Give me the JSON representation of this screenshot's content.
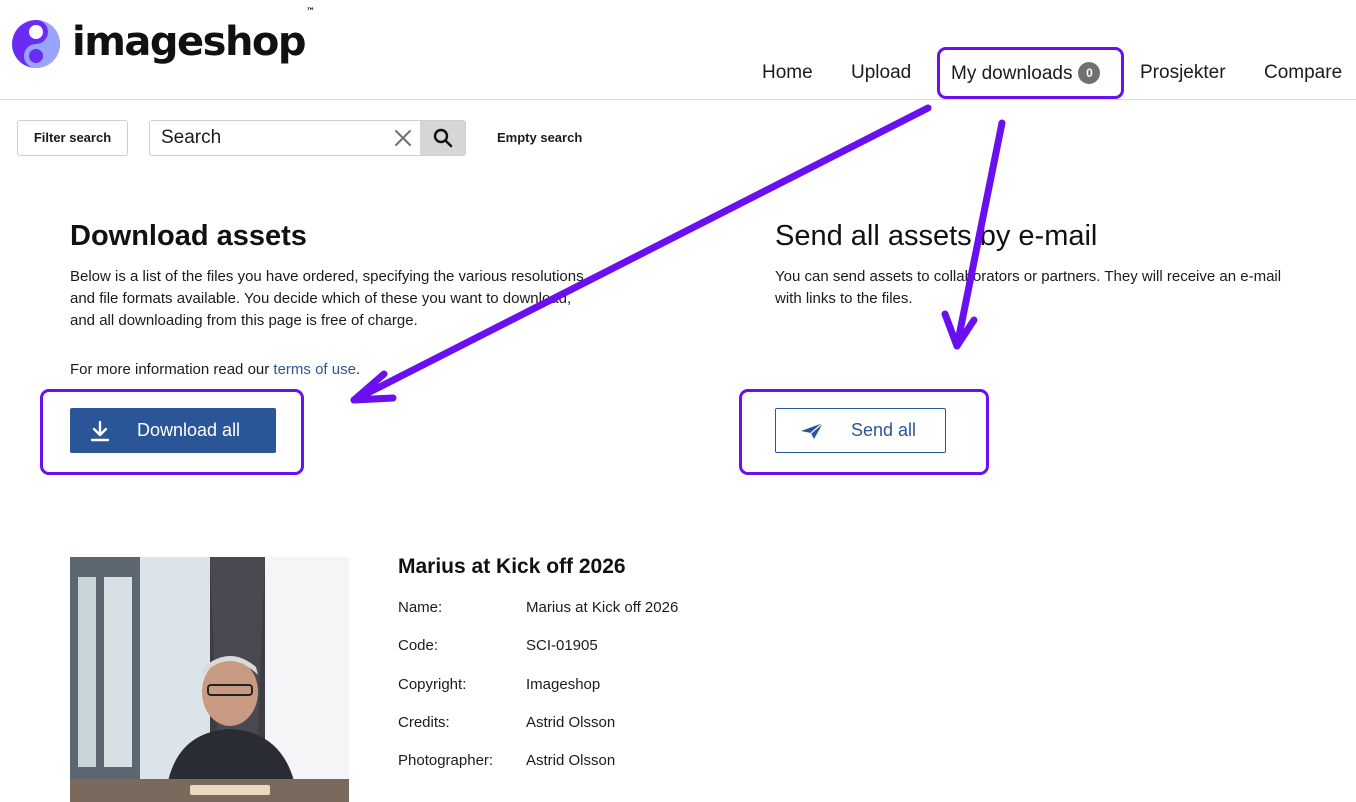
{
  "brand": {
    "name": "imageshop",
    "trademark": "™"
  },
  "nav": {
    "home": "Home",
    "upload": "Upload",
    "my_downloads": "My downloads",
    "my_downloads_count": "0",
    "projects": "Prosjekter",
    "compare": "Compare"
  },
  "search": {
    "filter_label": "Filter search",
    "placeholder": "Search",
    "value": "",
    "empty_label": "Empty search"
  },
  "download": {
    "heading": "Download assets",
    "text_line1": "Below is a list of the files you have ordered, specifying the various resolutions",
    "text_line2": "and file formats available. You decide which of these you want to download,",
    "text_line3": "and all downloading from this page is free of charge.",
    "info_prefix": "For more information read our ",
    "info_link": "terms of use",
    "info_suffix": ".",
    "button_label": "Download all"
  },
  "email": {
    "heading": "Send all assets by e-mail",
    "text_line1": "You can send assets to collaborators or partners. They will receive an e-mail",
    "text_line2": "with links to the files.",
    "button_label": "Send all"
  },
  "asset": {
    "title": "Marius at Kick off 2026",
    "fields": [
      {
        "label": "Name:",
        "value": "Marius at Kick off 2026"
      },
      {
        "label": "Code:",
        "value": "SCI-01905"
      },
      {
        "label": "Copyright:",
        "value": "Imageshop"
      },
      {
        "label": "Credits:",
        "value": "Astrid Olsson"
      },
      {
        "label": "Photographer:",
        "value": "Astrid Olsson"
      }
    ]
  },
  "colors": {
    "accent": "#2a5597",
    "annotation": "#6a0ff0",
    "badge": "#707070",
    "logo_primary": "#6a2cf5",
    "logo_secondary": "#9aa4ff"
  },
  "icons": {
    "logo": "imageshop-logo-icon",
    "clear": "close-icon",
    "search": "search-icon",
    "download": "download-icon",
    "send": "paper-plane-icon"
  }
}
